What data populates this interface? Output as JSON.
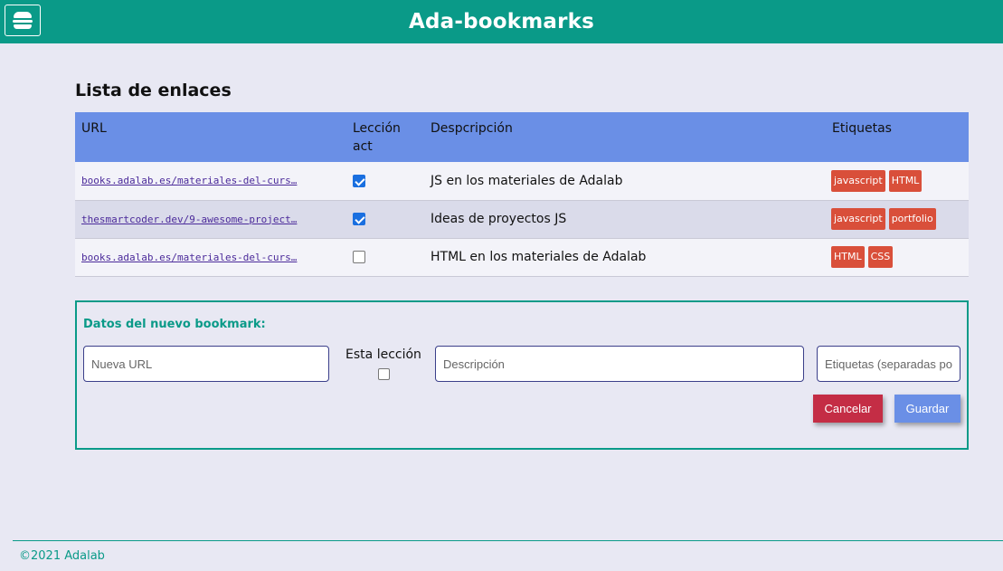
{
  "header": {
    "title": "Ada-bookmarks",
    "menu_icon": "hamburger-icon",
    "color": "#0a9a88"
  },
  "list": {
    "title": "Lista de enlaces",
    "columns": [
      "URL",
      "Lección act",
      "Despcripción",
      "Etiquetas"
    ],
    "header_color": "#6a8fe6",
    "rows": [
      {
        "url": "books.adalab.es/materiales-del-curs…",
        "lesson_checked": true,
        "description": "JS en los materiales de Adalab",
        "tags": [
          "javascript",
          "HTML"
        ]
      },
      {
        "url": "thesmartcoder.dev/9-awesome-project…",
        "lesson_checked": true,
        "description": "Ideas de proyectos JS",
        "tags": [
          "javascript",
          "portfolio"
        ]
      },
      {
        "url": "books.adalab.es/materiales-del-curs…",
        "lesson_checked": false,
        "description": "HTML en los materiales de Adalab",
        "tags": [
          "HTML",
          "CSS"
        ]
      }
    ],
    "tag_color": "#d94f3a"
  },
  "form": {
    "title": "Datos del nuevo bookmark:",
    "url_placeholder": "Nueva URL",
    "lesson_label": "Esta lección",
    "lesson_checked": false,
    "description_placeholder": "Descripción",
    "tags_placeholder": "Etiquetas (separadas por comas)",
    "cancel_label": "Cancelar",
    "save_label": "Guardar",
    "cancel_color": "#c42d45",
    "save_color": "#6a8fe6"
  },
  "footer": {
    "text": "©2021 Adalab"
  }
}
